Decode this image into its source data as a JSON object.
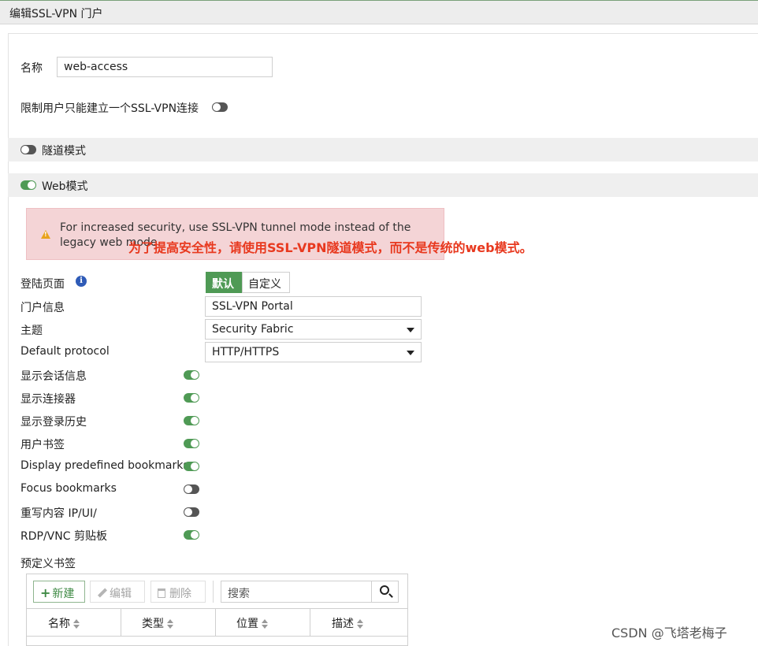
{
  "window": {
    "title": "编辑SSL-VPN 门户"
  },
  "form": {
    "name_label": "名称",
    "name_value": "web-access",
    "limit_label": "限制用户只能建立一个SSL-VPN连接",
    "limit_on": false
  },
  "sections": {
    "tunnel": {
      "label": "隧道模式",
      "on": false
    },
    "web": {
      "label": "Web模式",
      "on": true
    }
  },
  "alert": {
    "message": "For increased security, use SSL-VPN tunnel mode instead of the legacy web mode.",
    "annotation": "为了提高安全性，请使用SSL-VPN隧道模式，而不是传统的web模式。"
  },
  "web_settings": {
    "login_page_label": "登陆页面",
    "login_page_options": [
      "默认",
      "自定义"
    ],
    "login_page_selected": "默认",
    "portal_message_label": "门户信息",
    "portal_message_value": "SSL-VPN Portal",
    "theme_label": "主题",
    "theme_value": "Security Fabric",
    "protocol_label": "Default protocol",
    "protocol_value": "HTTP/HTTPS"
  },
  "toggles": [
    {
      "label": "显示会话信息",
      "on": true
    },
    {
      "label": "显示连接器",
      "on": true
    },
    {
      "label": "显示登录历史",
      "on": true
    },
    {
      "label": "用户书签",
      "on": true
    },
    {
      "label": "Display predefined bookmarks",
      "on": true
    },
    {
      "label": "Focus bookmarks",
      "on": false
    },
    {
      "label": "重写内容 IP/UI/",
      "on": false
    },
    {
      "label": "RDP/VNC 剪贴板",
      "on": true
    }
  ],
  "bookmarks": {
    "title": "预定义书签",
    "new_label": "新建",
    "edit_label": "编辑",
    "delete_label": "删除",
    "search_placeholder": "搜索",
    "columns": [
      "名称",
      "类型",
      "位置",
      "描述"
    ]
  },
  "watermark": "CSDN @飞塔老梅子",
  "colors": {
    "accent": "#4f9a55",
    "alert_bg": "#f4d4d6",
    "annotation": "#e8391f"
  }
}
